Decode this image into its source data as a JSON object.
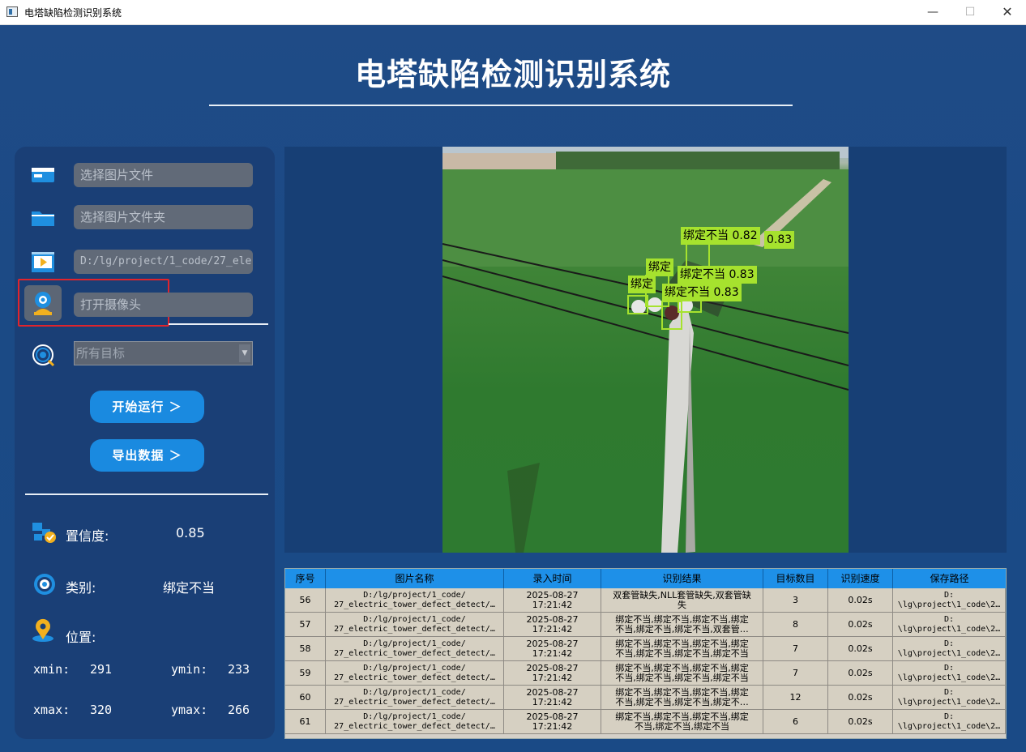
{
  "window": {
    "title": "电塔缺陷检测识别系统",
    "controls": {
      "minimize": "—",
      "maximize": "☐",
      "close": "✕"
    }
  },
  "header": {
    "title": "电塔缺陷检测识别系统"
  },
  "sidebar": {
    "image_file_placeholder": "选择图片文件",
    "image_folder_placeholder": "选择图片文件夹",
    "video_path_value": "D:/lg/project/1_code/27_ele",
    "camera_placeholder": "打开摄像头",
    "target_select_value": "所有目标",
    "start_button": "开始运行 ＞",
    "export_button": "导出数据 ＞",
    "confidence_label": "置信度:",
    "confidence_value": "0.85",
    "class_label": "类别:",
    "class_value": "绑定不当",
    "position_label": "位置:",
    "xmin_label": "xmin:",
    "xmin_value": "291",
    "ymin_label": "ymin:",
    "ymin_value": "233",
    "xmax_label": "xmax:",
    "xmax_value": "320",
    "ymax_label": "ymax:",
    "ymax_value": "266"
  },
  "detections": {
    "labels": [
      "绑定不当 0.82",
      "0.83",
      "绑定",
      "绑定不当 0.83",
      "绑定",
      "绑定不当 0.83"
    ]
  },
  "table": {
    "headers": [
      "序号",
      "图片名称",
      "录入时间",
      "识别结果",
      "目标数目",
      "识别速度",
      "保存路径"
    ],
    "rows": [
      {
        "id": "56",
        "name": "D:/lg/project/1_code/\n27_electric_tower_defect_detect/…",
        "time": "2025-08-27\n17:21:42",
        "result": "双套管缺失,NLL套管缺失,双套管缺\n失",
        "count": "3",
        "speed": "0.02s",
        "path": "D:\n\\lg\\project\\1_code\\2…"
      },
      {
        "id": "57",
        "name": "D:/lg/project/1_code/\n27_electric_tower_defect_detect/…",
        "time": "2025-08-27\n17:21:42",
        "result": "绑定不当,绑定不当,绑定不当,绑定\n不当,绑定不当,绑定不当,双套管…",
        "count": "8",
        "speed": "0.02s",
        "path": "D:\n\\lg\\project\\1_code\\2…"
      },
      {
        "id": "58",
        "name": "D:/lg/project/1_code/\n27_electric_tower_defect_detect/…",
        "time": "2025-08-27\n17:21:42",
        "result": "绑定不当,绑定不当,绑定不当,绑定\n不当,绑定不当,绑定不当,绑定不当",
        "count": "7",
        "speed": "0.02s",
        "path": "D:\n\\lg\\project\\1_code\\2…"
      },
      {
        "id": "59",
        "name": "D:/lg/project/1_code/\n27_electric_tower_defect_detect/…",
        "time": "2025-08-27\n17:21:42",
        "result": "绑定不当,绑定不当,绑定不当,绑定\n不当,绑定不当,绑定不当,绑定不当",
        "count": "7",
        "speed": "0.02s",
        "path": "D:\n\\lg\\project\\1_code\\2…"
      },
      {
        "id": "60",
        "name": "D:/lg/project/1_code/\n27_electric_tower_defect_detect/…",
        "time": "2025-08-27\n17:21:42",
        "result": "绑定不当,绑定不当,绑定不当,绑定\n不当,绑定不当,绑定不当,绑定不…",
        "count": "12",
        "speed": "0.02s",
        "path": "D:\n\\lg\\project\\1_code\\2…"
      },
      {
        "id": "61",
        "name": "D:/lg/project/1_code/\n27_electric_tower_defect_detect/…",
        "time": "2025-08-27\n17:21:42",
        "result": "绑定不当,绑定不当,绑定不当,绑定\n不当,绑定不当,绑定不当",
        "count": "6",
        "speed": "0.02s",
        "path": "D:\n\\lg\\project\\1_code\\2…"
      }
    ]
  },
  "colors": {
    "background": "#1f4b86",
    "panel": "#1a3f76",
    "accent": "#1a8ae0",
    "detection": "#a6e22e",
    "highlight": "#e0242c"
  },
  "icons": [
    "image-file-icon",
    "folder-icon",
    "video-icon",
    "camera-icon",
    "target-icon",
    "confidence-icon",
    "class-icon",
    "location-icon"
  ]
}
